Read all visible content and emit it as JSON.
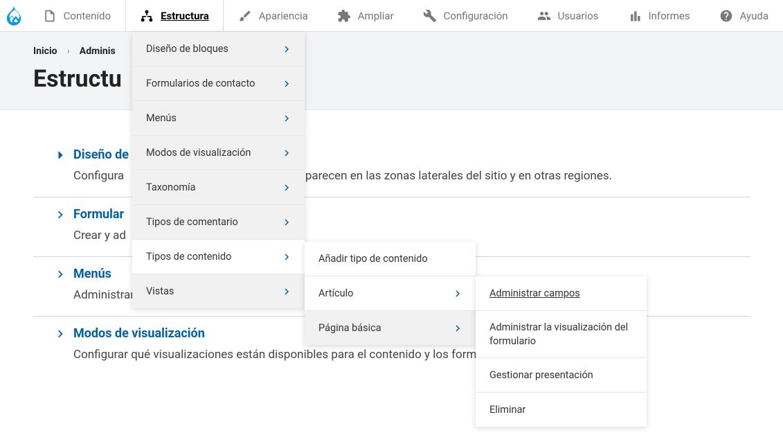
{
  "toolbar": {
    "items": [
      {
        "label": "Contenido"
      },
      {
        "label": "Estructura"
      },
      {
        "label": "Apariencia"
      },
      {
        "label": "Ampliar"
      },
      {
        "label": "Configuración"
      },
      {
        "label": "Usuarios"
      },
      {
        "label": "Informes"
      },
      {
        "label": "Ayuda"
      }
    ]
  },
  "breadcrumb": {
    "items": [
      "Inicio",
      "Adminis"
    ]
  },
  "page": {
    "title": "Estructu"
  },
  "content_items": [
    {
      "title": "Diseño de",
      "desc_pre": "Configura",
      "desc_post": "aparecen en las zonas laterales del sitio y en otras regiones."
    },
    {
      "title": "Formular",
      "desc": "Crear y ad"
    },
    {
      "title": "Menús",
      "desc": "Administrar menús y enlaces de menú."
    },
    {
      "title": "Modos de visualización",
      "desc": "Configurar qué visualizaciones están disponibles para el contenido y los formularios."
    }
  ],
  "dropdown1": [
    {
      "label": "Diseño de bloques"
    },
    {
      "label": "Formularios de contacto"
    },
    {
      "label": "Menús"
    },
    {
      "label": "Modos de visualización"
    },
    {
      "label": "Taxonomía"
    },
    {
      "label": "Tipos de comentario"
    },
    {
      "label": "Tipos de contenido"
    },
    {
      "label": "Vistas"
    }
  ],
  "dropdown2": [
    {
      "label": "Añadir tipo de contenido"
    },
    {
      "label": "Artículo"
    },
    {
      "label": "Página básica"
    }
  ],
  "dropdown3": [
    {
      "label": "Administrar campos"
    },
    {
      "label": "Administrar la visualización del formulario"
    },
    {
      "label": "Gestionar presentación"
    },
    {
      "label": "Eliminar"
    }
  ]
}
